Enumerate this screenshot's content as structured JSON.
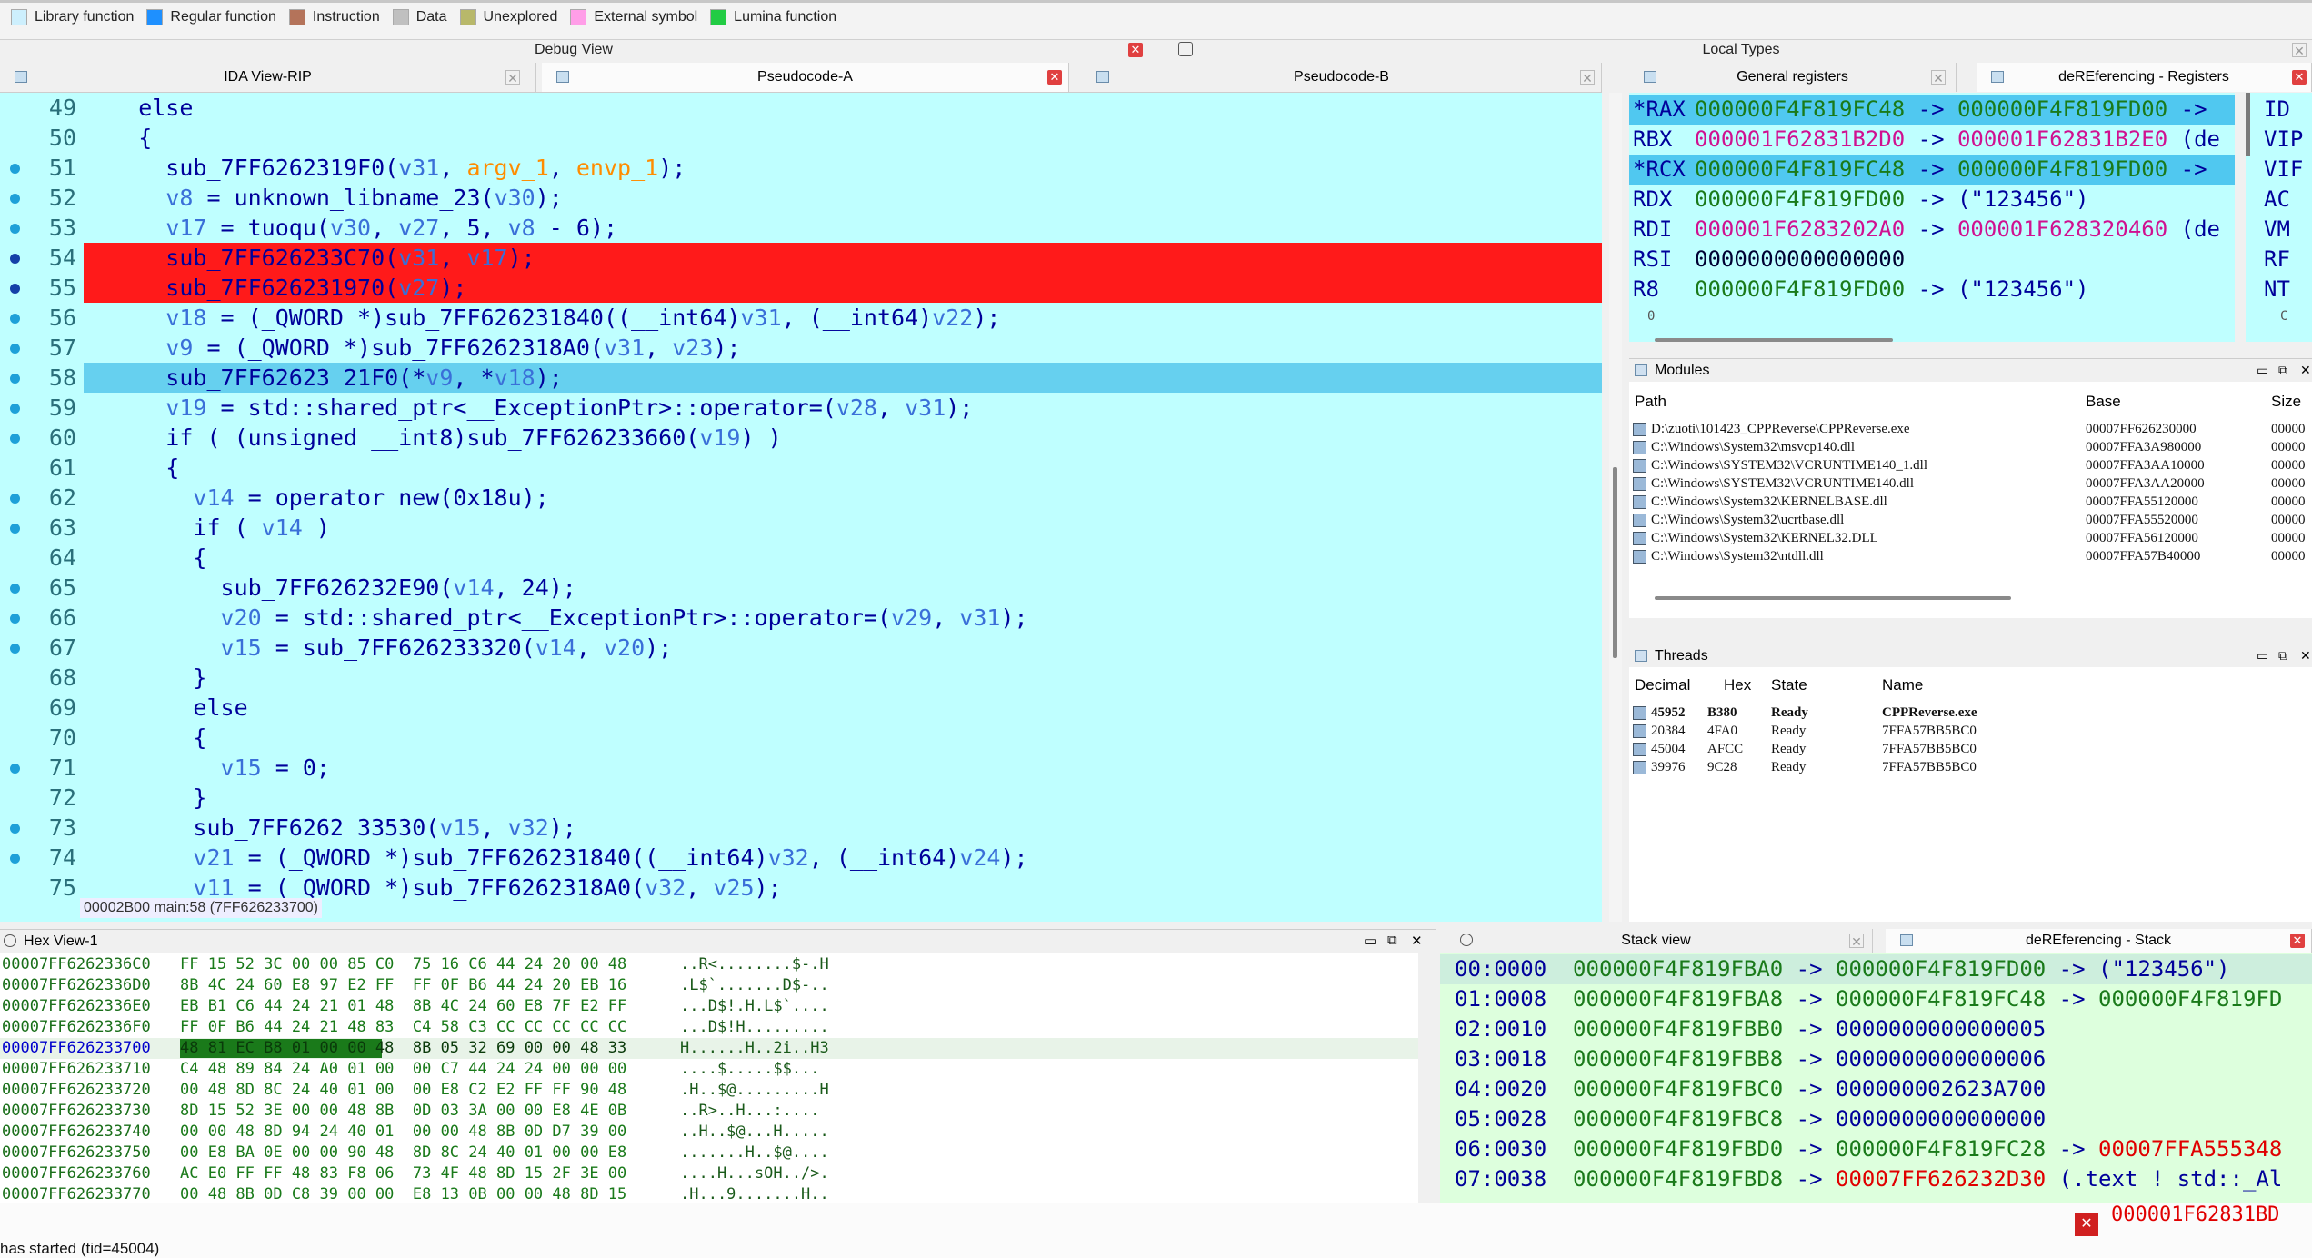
{
  "legend": [
    {
      "label": "Library function",
      "color": "#cdeffd"
    },
    {
      "label": "Regular function",
      "color": "#1e90ff"
    },
    {
      "label": "Instruction",
      "color": "#b4735a"
    },
    {
      "label": "Data",
      "color": "#c0c0c0"
    },
    {
      "label": "Unexplored",
      "color": "#b8b86a"
    },
    {
      "label": "External symbol",
      "color": "#ff9ee8"
    },
    {
      "label": "Lumina function",
      "color": "#22cc44"
    }
  ],
  "titles": {
    "debug_view": "Debug View",
    "local_types": "Local Types",
    "general_registers": "General registers",
    "deref_registers": "deREferencing - Registers",
    "modules": "Modules",
    "threads": "Threads",
    "hex_view": "Hex View-1",
    "stack_view": "Stack view",
    "deref_stack": "deREferencing - Stack"
  },
  "tabs": [
    "IDA View-RIP",
    "Pseudocode-A",
    "Pseudocode-B"
  ],
  "code": [
    {
      "n": "49",
      "dot": false,
      "hl": "",
      "segs": [
        [
          "    else",
          "#00009a"
        ]
      ]
    },
    {
      "n": "50",
      "dot": false,
      "hl": "",
      "segs": [
        [
          "    {",
          "#00009a"
        ]
      ]
    },
    {
      "n": "51",
      "dot": true,
      "hl": "",
      "segs": [
        [
          "      sub_7FF6262319F0(",
          "#00009a"
        ],
        [
          "v31",
          "#3a6fd8"
        ],
        [
          ", ",
          "#00009a"
        ],
        [
          "argv_1",
          "#ff8c00"
        ],
        [
          ", ",
          "#00009a"
        ],
        [
          "envp_1",
          "#ff8c00"
        ],
        [
          ");",
          "#00009a"
        ]
      ]
    },
    {
      "n": "52",
      "dot": true,
      "hl": "",
      "segs": [
        [
          "      ",
          "#00009a"
        ],
        [
          "v8",
          "#3a6fd8"
        ],
        [
          " = unknown_libname_23(",
          "#00009a"
        ],
        [
          "v30",
          "#3a6fd8"
        ],
        [
          ");",
          "#00009a"
        ]
      ]
    },
    {
      "n": "53",
      "dot": true,
      "hl": "",
      "segs": [
        [
          "      ",
          "#00009a"
        ],
        [
          "v17",
          "#3a6fd8"
        ],
        [
          " = tuoqu(",
          "#00009a"
        ],
        [
          "v30",
          "#3a6fd8"
        ],
        [
          ", ",
          "#00009a"
        ],
        [
          "v27",
          "#3a6fd8"
        ],
        [
          ", 5, ",
          "#00009a"
        ],
        [
          "v8",
          "#3a6fd8"
        ],
        [
          " - 6);",
          "#00009a"
        ]
      ]
    },
    {
      "n": "54",
      "dot": true,
      "hl": "red",
      "segs": [
        [
          "      sub_7FF626233C70(",
          "#00009a"
        ],
        [
          "v31",
          "#3a6fd8"
        ],
        [
          ", ",
          "#00009a"
        ],
        [
          "v17",
          "#3a6fd8"
        ],
        [
          ");",
          "#00009a"
        ]
      ]
    },
    {
      "n": "55",
      "dot": true,
      "hl": "red",
      "segs": [
        [
          "      sub_7FF626231970(",
          "#00009a"
        ],
        [
          "v27",
          "#3a6fd8"
        ],
        [
          ");",
          "#00009a"
        ]
      ]
    },
    {
      "n": "56",
      "dot": true,
      "hl": "",
      "segs": [
        [
          "      ",
          "#00009a"
        ],
        [
          "v18",
          "#3a6fd8"
        ],
        [
          " = (_QWORD *)sub_7FF626231840((__int64)",
          "#00009a"
        ],
        [
          "v31",
          "#3a6fd8"
        ],
        [
          ", (__int64)",
          "#00009a"
        ],
        [
          "v22",
          "#3a6fd8"
        ],
        [
          ");",
          "#00009a"
        ]
      ]
    },
    {
      "n": "57",
      "dot": true,
      "hl": "",
      "segs": [
        [
          "      ",
          "#00009a"
        ],
        [
          "v9",
          "#3a6fd8"
        ],
        [
          " = (_QWORD *)sub_7FF6262318A0(",
          "#00009a"
        ],
        [
          "v31",
          "#3a6fd8"
        ],
        [
          ", ",
          "#00009a"
        ],
        [
          "v23",
          "#3a6fd8"
        ],
        [
          ");",
          "#00009a"
        ]
      ]
    },
    {
      "n": "58",
      "dot": true,
      "hl": "blue",
      "segs": [
        [
          "      sub_7FF62623 21F0(*",
          "#00009a"
        ],
        [
          "v9",
          "#3a6fd8"
        ],
        [
          ", *",
          "#00009a"
        ],
        [
          "v18",
          "#3a6fd8"
        ],
        [
          ");",
          "#00009a"
        ]
      ]
    },
    {
      "n": "59",
      "dot": true,
      "hl": "",
      "segs": [
        [
          "      ",
          "#00009a"
        ],
        [
          "v19",
          "#3a6fd8"
        ],
        [
          " = std::shared_ptr<__ExceptionPtr>::operator=(",
          "#00009a"
        ],
        [
          "v28",
          "#3a6fd8"
        ],
        [
          ", ",
          "#00009a"
        ],
        [
          "v31",
          "#3a6fd8"
        ],
        [
          ");",
          "#00009a"
        ]
      ]
    },
    {
      "n": "60",
      "dot": true,
      "hl": "",
      "segs": [
        [
          "      if ( (unsigned __int8)sub_7FF626233660(",
          "#00009a"
        ],
        [
          "v19",
          "#3a6fd8"
        ],
        [
          ") )",
          "#00009a"
        ]
      ]
    },
    {
      "n": "61",
      "dot": false,
      "hl": "",
      "segs": [
        [
          "      {",
          "#00009a"
        ]
      ]
    },
    {
      "n": "62",
      "dot": true,
      "hl": "",
      "segs": [
        [
          "        ",
          "#00009a"
        ],
        [
          "v14",
          "#3a6fd8"
        ],
        [
          " = operator new(0x18u);",
          "#00009a"
        ]
      ]
    },
    {
      "n": "63",
      "dot": true,
      "hl": "",
      "segs": [
        [
          "        if ( ",
          "#00009a"
        ],
        [
          "v14",
          "#3a6fd8"
        ],
        [
          " )",
          "#00009a"
        ]
      ]
    },
    {
      "n": "64",
      "dot": false,
      "hl": "",
      "segs": [
        [
          "        {",
          "#00009a"
        ]
      ]
    },
    {
      "n": "65",
      "dot": true,
      "hl": "",
      "segs": [
        [
          "          sub_7FF626232E90(",
          "#00009a"
        ],
        [
          "v14",
          "#3a6fd8"
        ],
        [
          ", 24);",
          "#00009a"
        ]
      ]
    },
    {
      "n": "66",
      "dot": true,
      "hl": "",
      "segs": [
        [
          "          ",
          "#00009a"
        ],
        [
          "v20",
          "#3a6fd8"
        ],
        [
          " = std::shared_ptr<__ExceptionPtr>::operator=(",
          "#00009a"
        ],
        [
          "v29",
          "#3a6fd8"
        ],
        [
          ", ",
          "#00009a"
        ],
        [
          "v31",
          "#3a6fd8"
        ],
        [
          ");",
          "#00009a"
        ]
      ]
    },
    {
      "n": "67",
      "dot": true,
      "hl": "",
      "segs": [
        [
          "          ",
          "#00009a"
        ],
        [
          "v15",
          "#3a6fd8"
        ],
        [
          " = sub_7FF626233320(",
          "#00009a"
        ],
        [
          "v14",
          "#3a6fd8"
        ],
        [
          ", ",
          "#00009a"
        ],
        [
          "v20",
          "#3a6fd8"
        ],
        [
          ");",
          "#00009a"
        ]
      ]
    },
    {
      "n": "68",
      "dot": false,
      "hl": "",
      "segs": [
        [
          "        }",
          "#00009a"
        ]
      ]
    },
    {
      "n": "69",
      "dot": false,
      "hl": "",
      "segs": [
        [
          "        else",
          "#00009a"
        ]
      ]
    },
    {
      "n": "70",
      "dot": false,
      "hl": "",
      "segs": [
        [
          "        {",
          "#00009a"
        ]
      ]
    },
    {
      "n": "71",
      "dot": true,
      "hl": "",
      "segs": [
        [
          "          ",
          "#00009a"
        ],
        [
          "v15",
          "#3a6fd8"
        ],
        [
          " = 0;",
          "#00009a"
        ]
      ]
    },
    {
      "n": "72",
      "dot": false,
      "hl": "",
      "segs": [
        [
          "        }",
          "#00009a"
        ]
      ]
    },
    {
      "n": "73",
      "dot": true,
      "hl": "",
      "segs": [
        [
          "        sub_7FF6262 33530(",
          "#00009a"
        ],
        [
          "v15",
          "#3a6fd8"
        ],
        [
          ", ",
          "#00009a"
        ],
        [
          "v32",
          "#3a6fd8"
        ],
        [
          ");",
          "#00009a"
        ]
      ]
    },
    {
      "n": "74",
      "dot": true,
      "hl": "",
      "segs": [
        [
          "        ",
          "#00009a"
        ],
        [
          "v21",
          "#3a6fd8"
        ],
        [
          " = (_QWORD *)sub_7FF626231840((__int64)",
          "#00009a"
        ],
        [
          "v32",
          "#3a6fd8"
        ],
        [
          ", (__int64)",
          "#00009a"
        ],
        [
          "v24",
          "#3a6fd8"
        ],
        [
          ");",
          "#00009a"
        ]
      ]
    },
    {
      "n": "75",
      "dot": false,
      "hl": "",
      "segs": [
        [
          "        ",
          "#00009a"
        ],
        [
          "v11",
          "#3a6fd8"
        ],
        [
          " = (_QWORD *)sub_7FF6262318A0(",
          "#00009a"
        ],
        [
          "v32",
          "#3a6fd8"
        ],
        [
          ", ",
          "#00009a"
        ],
        [
          "v25",
          "#3a6fd8"
        ],
        [
          ");",
          "#00009a"
        ]
      ]
    }
  ],
  "code_status": "00002B00 main:58 (7FF626233700)",
  "registers": [
    {
      "name": "*RAX",
      "sel": true,
      "segs": [
        [
          "000000F4F819FC48",
          "#1a7a1a"
        ],
        [
          " -> ",
          "#00009a"
        ],
        [
          "000000F4F819FD00",
          "#1a7a1a"
        ],
        [
          " ->",
          "#00009a"
        ]
      ]
    },
    {
      "name": "RBX",
      "sel": false,
      "segs": [
        [
          "000001F62831B2D0",
          "#d01090"
        ],
        [
          " -> ",
          "#00009a"
        ],
        [
          "000001F62831B2E0",
          "#d01090"
        ],
        [
          " (de",
          "#00009a"
        ]
      ]
    },
    {
      "name": "*RCX",
      "sel": true,
      "segs": [
        [
          "000000F4F819FC48",
          "#1a7a1a"
        ],
        [
          " -> ",
          "#00009a"
        ],
        [
          "000000F4F819FD00",
          "#1a7a1a"
        ],
        [
          " ->",
          "#00009a"
        ]
      ]
    },
    {
      "name": "RDX",
      "sel": false,
      "segs": [
        [
          "000000F4F819FD00",
          "#1a7a1a"
        ],
        [
          " -> (\"123456\")",
          "#00009a"
        ]
      ]
    },
    {
      "name": "RDI",
      "sel": false,
      "segs": [
        [
          "000001F6283202A0",
          "#d01090"
        ],
        [
          " -> ",
          "#00009a"
        ],
        [
          "000001F628320460",
          "#d01090"
        ],
        [
          " (de",
          "#00009a"
        ]
      ]
    },
    {
      "name": "RSI",
      "sel": false,
      "segs": [
        [
          "0000000000000000",
          "#000033"
        ]
      ]
    },
    {
      "name": "R8",
      "sel": false,
      "segs": [
        [
          "000000F4F819FD00",
          "#1a7a1a"
        ],
        [
          " -> (\"123456\")",
          "#00009a"
        ]
      ]
    }
  ],
  "reg_flags": [
    "ID",
    "VIP",
    "VIF",
    "AC",
    "VM",
    "RF",
    "NT"
  ],
  "reg_footer_left": "0",
  "reg_footer_right": "C",
  "modules_headers": [
    "Path",
    "Base",
    "Size"
  ],
  "modules": [
    {
      "path": "D:\\zuoti\\101423_CPPReverse\\CPPReverse.exe",
      "base": "00007FF626230000",
      "size": "00000"
    },
    {
      "path": "C:\\Windows\\System32\\msvcp140.dll",
      "base": "00007FFA3A980000",
      "size": "00000"
    },
    {
      "path": "C:\\Windows\\SYSTEM32\\VCRUNTIME140_1.dll",
      "base": "00007FFA3AA10000",
      "size": "00000"
    },
    {
      "path": "C:\\Windows\\SYSTEM32\\VCRUNTIME140.dll",
      "base": "00007FFA3AA20000",
      "size": "00000"
    },
    {
      "path": "C:\\Windows\\System32\\KERNELBASE.dll",
      "base": "00007FFA55120000",
      "size": "00000"
    },
    {
      "path": "C:\\Windows\\System32\\ucrtbase.dll",
      "base": "00007FFA55520000",
      "size": "00000"
    },
    {
      "path": "C:\\Windows\\System32\\KERNEL32.DLL",
      "base": "00007FFA56120000",
      "size": "00000"
    },
    {
      "path": "C:\\Windows\\System32\\ntdll.dll",
      "base": "00007FFA57B40000",
      "size": "00000"
    }
  ],
  "threads_headers": [
    "Decimal",
    "Hex",
    "State",
    "Name"
  ],
  "threads": [
    {
      "dec": "45952",
      "hex": "B380",
      "state": "Ready",
      "name": "CPPReverse.exe",
      "bold": true
    },
    {
      "dec": "20384",
      "hex": "4FA0",
      "state": "Ready",
      "name": "7FFA57BB5BC0",
      "bold": false
    },
    {
      "dec": "45004",
      "hex": "AFCC",
      "state": "Ready",
      "name": "7FFA57BB5BC0",
      "bold": false
    },
    {
      "dec": "39976",
      "hex": "9C28",
      "state": "Ready",
      "name": "7FFA57BB5BC0",
      "bold": false
    }
  ],
  "hex": [
    {
      "addr": "00007FF6262336C0",
      "bytes": "FF 15 52 3C 00 00 85 C0  75 16 C6 44 24 20 00 48",
      "ascii": "..R<........$-.H",
      "sel": false
    },
    {
      "addr": "00007FF6262336D0",
      "bytes": "8B 4C 24 60 E8 97 E2 FF  FF 0F B6 44 24 20 EB 16",
      "ascii": ".L$`.......D$-..",
      "sel": false
    },
    {
      "addr": "00007FF6262336E0",
      "bytes": "EB B1 C6 44 24 21 01 48  8B 4C 24 60 E8 7F E2 FF",
      "ascii": "...D$!.H.L$`....",
      "sel": false
    },
    {
      "addr": "00007FF6262336F0",
      "bytes": "FF 0F B6 44 24 21 48 83  C4 58 C3 CC CC CC CC CC",
      "ascii": "...D$!H.........",
      "sel": false
    },
    {
      "addr": "00007FF626233700",
      "bytes": "48 81 EC B8 01 00 00 48  8B 05 32 69 00 00 48 33",
      "ascii": "H......H..2i..H3",
      "sel": true
    },
    {
      "addr": "00007FF626233710",
      "bytes": "C4 48 89 84 24 A0 01 00  00 C7 44 24 24 00 00 00",
      "ascii": "....$.....$$...",
      "sel": false
    },
    {
      "addr": "00007FF626233720",
      "bytes": "00 48 8D 8C 24 40 01 00  00 E8 C2 E2 FF FF 90 48",
      "ascii": ".H..$@.........H",
      "sel": false
    },
    {
      "addr": "00007FF626233730",
      "bytes": "8D 15 52 3E 00 00 48 8B  0D 03 3A 00 00 E8 4E 0B",
      "ascii": "..R>..H...:....",
      "sel": false
    },
    {
      "addr": "00007FF626233740",
      "bytes": "00 00 48 8D 94 24 40 01  00 00 48 8B 0D D7 39 00",
      "ascii": "..H..$@...H.....",
      "sel": false
    },
    {
      "addr": "00007FF626233750",
      "bytes": "00 E8 BA 0E 00 00 90 48  8D 8C 24 40 01 00 00 E8",
      "ascii": ".......H..$@....",
      "sel": false
    },
    {
      "addr": "00007FF626233760",
      "bytes": "AC E0 FF FF 48 83 F8 06  73 4F 48 8D 15 2F 3E 00",
      "ascii": "....H...sOH../>.",
      "sel": false
    },
    {
      "addr": "00007FF626233770",
      "bytes": "00 48 8B 0D C8 39 00 00  E8 13 0B 00 00 48 8D 15",
      "ascii": ".H...9.......H..",
      "sel": false
    }
  ],
  "stack": [
    {
      "sel": true,
      "segs": [
        [
          "00:0000  ",
          "#00009a"
        ],
        [
          "000000F4F819FBA0",
          "#1a7a1a"
        ],
        [
          " -> ",
          "#00009a"
        ],
        [
          "000000F4F819FD00",
          "#1a7a1a"
        ],
        [
          " -> (\"123456\")",
          "#00009a"
        ]
      ]
    },
    {
      "sel": false,
      "segs": [
        [
          "01:0008  ",
          "#00009a"
        ],
        [
          "000000F4F819FBA8",
          "#1a7a1a"
        ],
        [
          " -> ",
          "#00009a"
        ],
        [
          "000000F4F819FC48",
          "#1a7a1a"
        ],
        [
          " -> ",
          "#00009a"
        ],
        [
          "000000F4F819FD",
          "#1a7a1a"
        ]
      ]
    },
    {
      "sel": false,
      "segs": [
        [
          "02:0010  ",
          "#00009a"
        ],
        [
          "000000F4F819FBB0",
          "#1a7a1a"
        ],
        [
          " -> 0000000000000005",
          "#00009a"
        ]
      ]
    },
    {
      "sel": false,
      "segs": [
        [
          "03:0018  ",
          "#00009a"
        ],
        [
          "000000F4F819FBB8",
          "#1a7a1a"
        ],
        [
          " -> 0000000000000006",
          "#00009a"
        ]
      ]
    },
    {
      "sel": false,
      "segs": [
        [
          "04:0020  ",
          "#00009a"
        ],
        [
          "000000F4F819FBC0",
          "#1a7a1a"
        ],
        [
          " -> 000000002623A700",
          "#00009a"
        ]
      ]
    },
    {
      "sel": false,
      "segs": [
        [
          "05:0028  ",
          "#00009a"
        ],
        [
          "000000F4F819FBC8",
          "#1a7a1a"
        ],
        [
          " -> 0000000000000000",
          "#00009a"
        ]
      ]
    },
    {
      "sel": false,
      "segs": [
        [
          "06:0030  ",
          "#00009a"
        ],
        [
          "000000F4F819FBD0",
          "#1a7a1a"
        ],
        [
          " -> ",
          "#00009a"
        ],
        [
          "000000F4F819FC28",
          "#1a7a1a"
        ],
        [
          " -> ",
          "#00009a"
        ],
        [
          "00007FFA555348",
          "#e00000"
        ]
      ]
    },
    {
      "sel": false,
      "segs": [
        [
          "07:0038  ",
          "#00009a"
        ],
        [
          "000000F4F819FBD8",
          "#1a7a1a"
        ],
        [
          " -> ",
          "#00009a"
        ],
        [
          "00007FF626232D30",
          "#e00000"
        ],
        [
          " (.text ! std::_Al",
          "#00009a"
        ]
      ]
    }
  ],
  "stack_overflow_text": "000001F62831BD",
  "output_text": "has started (tid=45004)"
}
